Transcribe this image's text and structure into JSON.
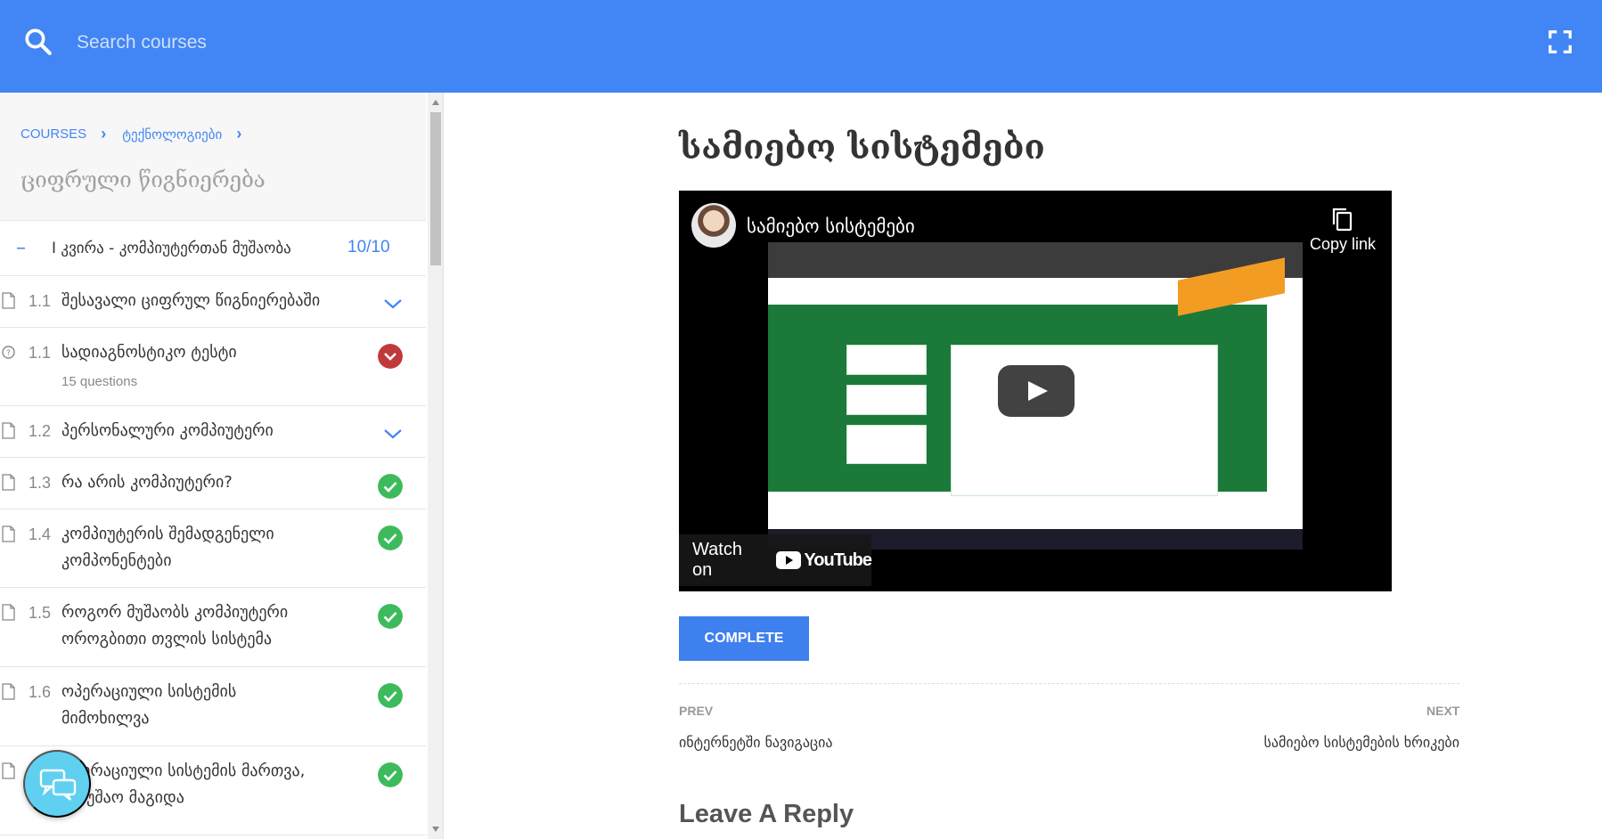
{
  "header": {
    "search_placeholder": "Search courses",
    "accent_color": "#4285f4"
  },
  "sidebar": {
    "breadcrumb": [
      "COURSES",
      "ტექნოლოგიები"
    ],
    "course_title": "ციფრული წიგნიერება",
    "section": {
      "toggle": "–",
      "title": "I კვირა - კომპიუტერთან მუშაობა",
      "count": "10/10"
    },
    "lessons": [
      {
        "num": "1.1",
        "title": "შესავალი ციფრულ წიგნიერებაში",
        "sub": "",
        "status": "expand",
        "icon": "document-icon"
      },
      {
        "num": "1.1",
        "title": "სადიაგნოსტიკო ტესტი",
        "sub": "15 questions",
        "status": "failed",
        "icon": "quiz-icon"
      },
      {
        "num": "1.2",
        "title": "პერსონალური კომპიუტერი",
        "sub": "",
        "status": "expand",
        "icon": "document-icon"
      },
      {
        "num": "1.3",
        "title": "რა არის კომპიუტერი?",
        "sub": "",
        "status": "completed",
        "icon": "document-icon"
      },
      {
        "num": "1.4",
        "title": "კომპიუტერის შემადგენელი კომპონენტები",
        "sub": "",
        "status": "completed",
        "icon": "document-icon"
      },
      {
        "num": "1.5",
        "title": "როგორ მუშაობს კომპიუტერი ოროგბითი თვლის სისტემა",
        "sub": "",
        "status": "completed",
        "icon": "document-icon"
      },
      {
        "num": "1.6",
        "title": "ოპერაციული სისტემის მიმოხილვა",
        "sub": "",
        "status": "completed",
        "icon": "document-icon"
      },
      {
        "num": "",
        "title": "ოპერაციული სისტემის მართვა, სამუშაო მაგიდა",
        "sub": "",
        "status": "completed",
        "icon": "document-icon"
      }
    ],
    "status_colors": {
      "completed": "#3dbb5c",
      "failed": "#c0393b",
      "expand": "#4285f4"
    }
  },
  "main": {
    "title": "სამიებო სისტემები",
    "video": {
      "title": "სამიებო სისტემები",
      "copy_link": "Copy link",
      "watch_on": "Watch on",
      "platform": "YouTube"
    },
    "complete_label": "COMPLETE",
    "nav": {
      "prev_label": "PREV",
      "prev_title": "ინტერნეტში ნავიგაცია",
      "next_label": "NEXT",
      "next_title": "სამიებო სისტემების ხრიკები"
    },
    "reply_heading": "Leave A Reply"
  }
}
